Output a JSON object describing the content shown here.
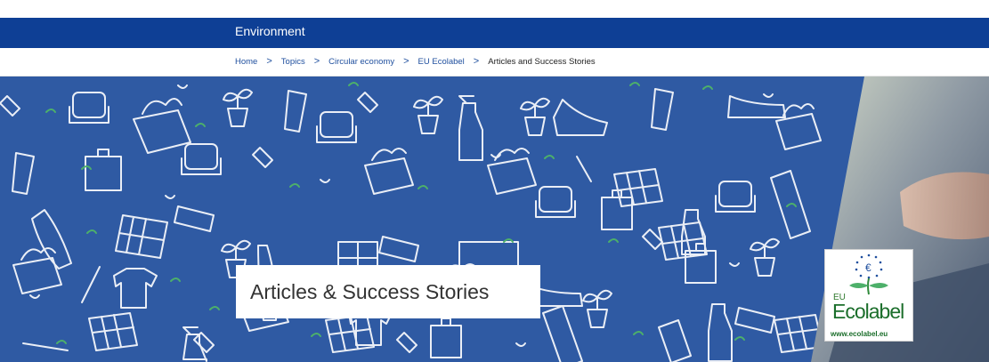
{
  "site": {
    "title": "Environment"
  },
  "breadcrumb": {
    "items": [
      "Home",
      "Topics",
      "Circular economy",
      "EU Ecolabel"
    ],
    "current": "Articles and Success Stories"
  },
  "hero": {
    "title": "Articles & Success Stories",
    "ecolabel": {
      "eu": "EU",
      "name": "Ecolabel",
      "url": "www.ecolabel.eu"
    },
    "colors": {
      "background": "#2f5aa3",
      "pattern": "#ffffff",
      "accent": "#4db06a"
    }
  }
}
